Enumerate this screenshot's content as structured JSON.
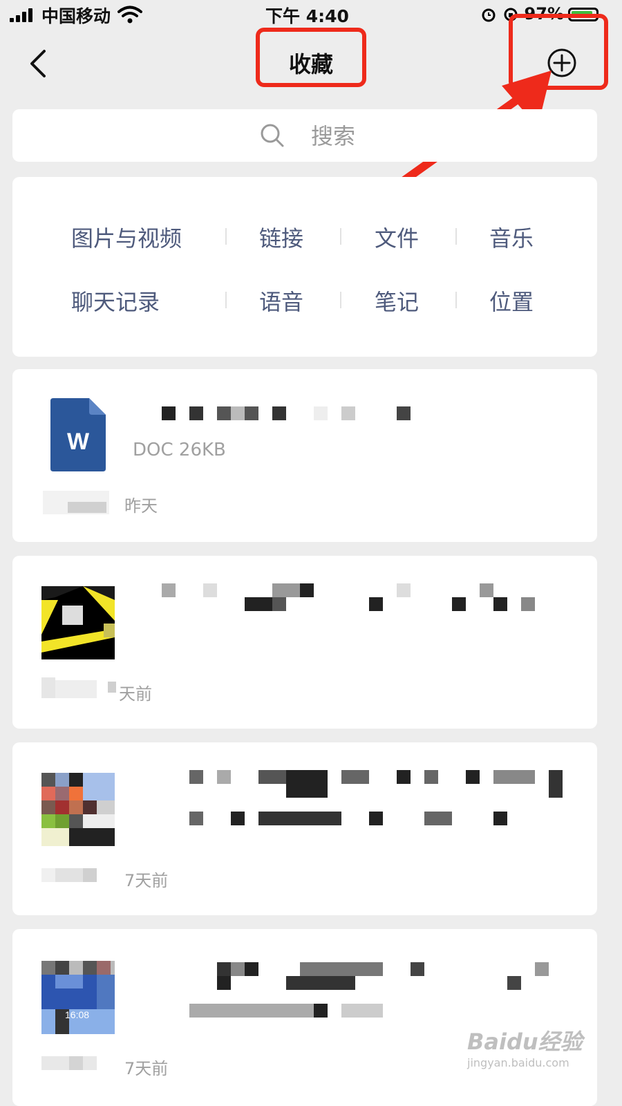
{
  "status_bar": {
    "carrier": "中国移动",
    "time": "下午 4:40",
    "battery": "97%"
  },
  "nav": {
    "title": "收藏"
  },
  "search": {
    "placeholder": "搜索"
  },
  "categories": [
    "图片与视频",
    "链接",
    "文件",
    "音乐",
    "聊天记录",
    "语音",
    "笔记",
    "位置"
  ],
  "items": [
    {
      "icon": "W",
      "meta": "DOC 26KB",
      "time": "昨天"
    },
    {
      "time": "天前"
    },
    {
      "time": "7天前"
    },
    {
      "time": "7天前",
      "thumb_time": "16:08"
    }
  ],
  "watermark": {
    "main": "Baidu经验",
    "sub": "jingyan.baidu.com"
  },
  "colors": {
    "highlight": "#ee2a1b",
    "category_text": "#4e5a7c",
    "word_blue": "#2b579a"
  }
}
